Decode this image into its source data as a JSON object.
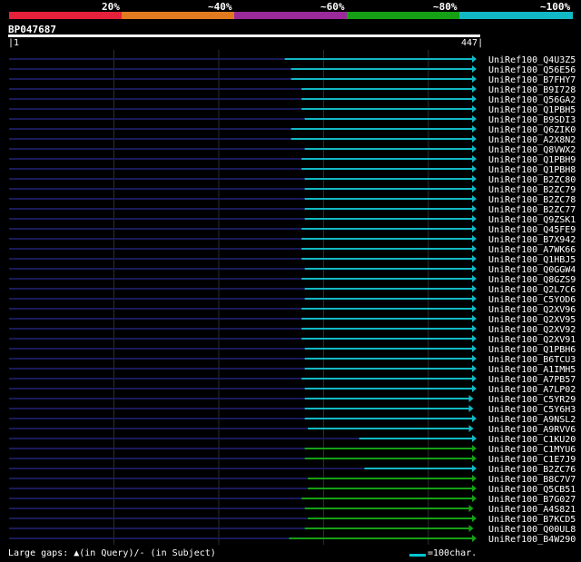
{
  "legend": {
    "labels": [
      "20%",
      "~40%",
      "~60%",
      "~80%",
      "~100%"
    ],
    "colors": [
      "#e5203a",
      "#e07a20",
      "#9a2a9a",
      "#15a015",
      "#12b8c4"
    ]
  },
  "query": {
    "title": "BP047687",
    "start": "1",
    "end": "447"
  },
  "footer": {
    "gaps_text": "Large gaps: ▲(in Query)/- (in Subject)",
    "scale_text": "=100char."
  },
  "chart_data": {
    "type": "alignment",
    "title": "BP047687",
    "x_range": [
      1,
      447
    ],
    "hits": [
      {
        "name": "UniRef100_Q4U3Z5",
        "start": 264,
        "end": 447,
        "identity": "~100%"
      },
      {
        "name": "UniRef100_Q56E56",
        "start": 270,
        "end": 447,
        "identity": "~100%"
      },
      {
        "name": "UniRef100_B7FHY7",
        "start": 270,
        "end": 447,
        "identity": "~100%"
      },
      {
        "name": "UniRef100_B9I728",
        "start": 280,
        "end": 447,
        "identity": "~100%"
      },
      {
        "name": "UniRef100_Q56GA2",
        "start": 280,
        "end": 447,
        "identity": "~100%"
      },
      {
        "name": "UniRef100_Q1PBH5",
        "start": 280,
        "end": 447,
        "identity": "~100%"
      },
      {
        "name": "UniRef100_B9SDI3",
        "start": 283,
        "end": 447,
        "identity": "~100%"
      },
      {
        "name": "UniRef100_Q6ZIK0",
        "start": 270,
        "end": 447,
        "identity": "~100%"
      },
      {
        "name": "UniRef100_A2X8N2",
        "start": 270,
        "end": 447,
        "identity": "~100%"
      },
      {
        "name": "UniRef100_Q8VWX2",
        "start": 283,
        "end": 447,
        "identity": "~100%"
      },
      {
        "name": "UniRef100_Q1PBH9",
        "start": 280,
        "end": 447,
        "identity": "~100%"
      },
      {
        "name": "UniRef100_Q1PBH8",
        "start": 280,
        "end": 447,
        "identity": "~100%"
      },
      {
        "name": "UniRef100_B2ZC80",
        "start": 283,
        "end": 447,
        "identity": "~100%"
      },
      {
        "name": "UniRef100_B2ZC79",
        "start": 283,
        "end": 447,
        "identity": "~100%"
      },
      {
        "name": "UniRef100_B2ZC78",
        "start": 283,
        "end": 447,
        "identity": "~100%"
      },
      {
        "name": "UniRef100_B2ZC77",
        "start": 283,
        "end": 447,
        "identity": "~100%"
      },
      {
        "name": "UniRef100_Q9ZSK1",
        "start": 283,
        "end": 447,
        "identity": "~100%"
      },
      {
        "name": "UniRef100_Q45FE9",
        "start": 280,
        "end": 447,
        "identity": "~100%"
      },
      {
        "name": "UniRef100_B7X942",
        "start": 280,
        "end": 447,
        "identity": "~100%"
      },
      {
        "name": "UniRef100_A7WK66",
        "start": 280,
        "end": 447,
        "identity": "~100%"
      },
      {
        "name": "UniRef100_Q1HBJ5",
        "start": 280,
        "end": 447,
        "identity": "~100%"
      },
      {
        "name": "UniRef100_Q0GGW4",
        "start": 283,
        "end": 447,
        "identity": "~100%"
      },
      {
        "name": "UniRef100_Q8GZS9",
        "start": 280,
        "end": 447,
        "identity": "~100%"
      },
      {
        "name": "UniRef100_Q2L7C6",
        "start": 283,
        "end": 447,
        "identity": "~100%"
      },
      {
        "name": "UniRef100_C5YOD6",
        "start": 283,
        "end": 447,
        "identity": "~100%"
      },
      {
        "name": "UniRef100_Q2XV96",
        "start": 280,
        "end": 447,
        "identity": "~100%"
      },
      {
        "name": "UniRef100_Q2XV95",
        "start": 280,
        "end": 447,
        "identity": "~100%"
      },
      {
        "name": "UniRef100_Q2XV92",
        "start": 280,
        "end": 447,
        "identity": "~100%"
      },
      {
        "name": "UniRef100_Q2XV91",
        "start": 280,
        "end": 447,
        "identity": "~100%"
      },
      {
        "name": "UniRef100_Q1PBH6",
        "start": 283,
        "end": 447,
        "identity": "~100%"
      },
      {
        "name": "UniRef100_B6TCU3",
        "start": 283,
        "end": 447,
        "identity": "~100%"
      },
      {
        "name": "UniRef100_A1IMH5",
        "start": 283,
        "end": 447,
        "identity": "~100%"
      },
      {
        "name": "UniRef100_A7PB57",
        "start": 280,
        "end": 447,
        "identity": "~100%"
      },
      {
        "name": "UniRef100_A7LP02",
        "start": 283,
        "end": 447,
        "identity": "~100%"
      },
      {
        "name": "UniRef100_C5YR29",
        "start": 283,
        "end": 444,
        "identity": "~100%"
      },
      {
        "name": "UniRef100_C5Y6H3",
        "start": 283,
        "end": 444,
        "identity": "~100%"
      },
      {
        "name": "UniRef100_A9NSL2",
        "start": 283,
        "end": 447,
        "identity": "~100%"
      },
      {
        "name": "UniRef100_A9RVV6",
        "start": 286,
        "end": 444,
        "identity": "~100%"
      },
      {
        "name": "UniRef100_C1KU20",
        "start": 335,
        "end": 447,
        "identity": "~100%"
      },
      {
        "name": "UniRef100_C1MYU6",
        "start": 283,
        "end": 447,
        "identity": "~80%"
      },
      {
        "name": "UniRef100_C1E7J9",
        "start": 283,
        "end": 447,
        "identity": "~80%"
      },
      {
        "name": "UniRef100_B2ZC76",
        "start": 340,
        "end": 447,
        "identity": "~100%"
      },
      {
        "name": "UniRef100_B8C7V7",
        "start": 286,
        "end": 447,
        "identity": "~80%"
      },
      {
        "name": "UniRef100_Q5CB51",
        "start": 286,
        "end": 447,
        "identity": "~80%"
      },
      {
        "name": "UniRef100_B7G027",
        "start": 280,
        "end": 447,
        "identity": "~80%"
      },
      {
        "name": "UniRef100_A4S821",
        "start": 283,
        "end": 444,
        "identity": "~80%"
      },
      {
        "name": "UniRef100_B7KCD5",
        "start": 286,
        "end": 447,
        "identity": "~80%"
      },
      {
        "name": "UniRef100_Q00UL8",
        "start": 283,
        "end": 444,
        "identity": "~80%"
      },
      {
        "name": "UniRef100_B4W290",
        "start": 268,
        "end": 447,
        "identity": "~80%"
      }
    ]
  }
}
